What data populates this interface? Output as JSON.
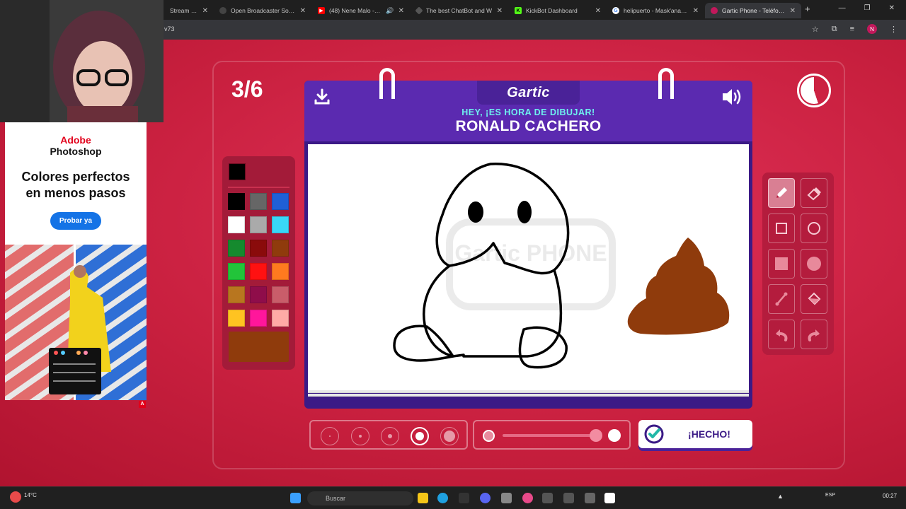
{
  "browser": {
    "tabs": [
      {
        "title": "Stream - W",
        "favicon_color": "#2b2b2b"
      },
      {
        "title": "Open Broadcaster Softwa",
        "favicon_color": "#444444"
      },
      {
        "title": "(48) Nene Malo - Baile",
        "favicon_color": "#ff0000"
      },
      {
        "title": "The best ChatBot and W",
        "favicon_color": "#555555"
      },
      {
        "title": "KickBot Dashboard",
        "favicon_color": "#53fc18"
      },
      {
        "title": "helipuerto - Mask'ana Go",
        "favicon_color": "#4285f4"
      },
      {
        "title": "Gartic Phone - Teléfono D",
        "favicon_color": "#c2185b",
        "active": true
      }
    ],
    "new_tab": "+",
    "url_fragment": "v73",
    "profile_initial": "N"
  },
  "game": {
    "round": "3/6",
    "logo": "Gartic",
    "subtitle": "HEY, ¡ES HORA DE DIBUJAR!",
    "prompt": "RONALD CACHERO",
    "timer_fraction_remaining": 0.55,
    "watermark": "Gartic PHONE",
    "done_label": "¡HECHO!",
    "selected_color": "#000000",
    "palette": [
      [
        "#000000",
        "#666666",
        "#1f5fd6"
      ],
      [
        "#ffffff",
        "#aaaaaa",
        "#39d7f7"
      ],
      [
        "#158a2e",
        "#8a0b0b",
        "#8f3b0c"
      ],
      [
        "#22c43a",
        "#ff1111",
        "#ff7a1f"
      ],
      [
        "#b8761f",
        "#8f0d4a",
        "#c95d6a"
      ],
      [
        "#ffc321",
        "#ff169b",
        "#ffaaa6"
      ]
    ],
    "custom_color": "#8f3b0c",
    "tools": [
      "pencil-icon",
      "eraser-icon",
      "rectangle-outline-icon",
      "circle-outline-icon",
      "rectangle-fill-icon",
      "circle-fill-icon",
      "line-icon",
      "bucket-fill-icon",
      "undo-icon",
      "redo-icon"
    ],
    "active_tool": "pencil-icon",
    "brush_sizes": 5,
    "active_brush_size_index": 3
  },
  "ad": {
    "brand_line1": "Adobe",
    "brand_line2": "Photoshop",
    "headline_line1": "Colores perfectos",
    "headline_line2": "en menos pasos",
    "cta": "Probar ya",
    "badge": "A"
  },
  "taskbar": {
    "weather": "14°C",
    "search_placeholder": "Buscar",
    "language": "ESP",
    "time": "00:27"
  }
}
